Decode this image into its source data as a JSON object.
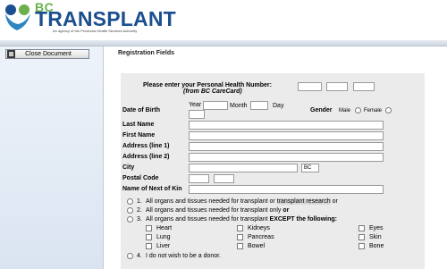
{
  "header": {
    "logo_bc": "BC",
    "logo_name": "TRANSPLANT",
    "tagline": "An agency of the Provincial Health Services Authority"
  },
  "sidebar": {
    "close_label": "Close Document"
  },
  "main": {
    "section_title": "Registration Fields",
    "phn_prompt": "Please enter your Personal Health Number:",
    "phn_sub": "(from BC CareCard)",
    "dob_label": "Date of Birth",
    "year_label": "Year",
    "month_label": "Month",
    "day_label": "Day",
    "gender_label": "Gender",
    "male_label": "Male",
    "female_label": "Female",
    "last_name": "Last Name",
    "first_name": "First Name",
    "address1": "Address (line 1)",
    "address2": "Address (line 2)",
    "city": "City",
    "province_value": "BC",
    "postal": "Postal Code",
    "next_of_kin": "Name of Next of Kin",
    "options": {
      "o1_num": "1.",
      "o1_a": "All organs and tissues needed for transplant or ",
      "o1_b": "transplant research",
      "o1_c": " or",
      "o2_num": "2.",
      "o2_a": "All organs and tissues needed for transplant only ",
      "o2_b": "or",
      "o3_num": "3.",
      "o3_a": "All organs and tissues needed for transplant ",
      "o3_b": "EXCEPT the following:",
      "o4_num": "4.",
      "o4_a": "I do not wish to be a donor."
    },
    "organs": {
      "heart": "Heart",
      "kidneys": "Kidneys",
      "eyes": "Eyes",
      "lung": "Lung",
      "pancreas": "Pancreas",
      "skin": "Skin",
      "liver": "Liver",
      "bowel": "Bowel",
      "bone": "Bone"
    }
  }
}
